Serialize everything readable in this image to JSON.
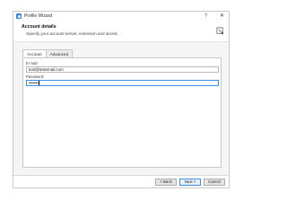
{
  "window": {
    "title": "Profile Wizard",
    "help_glyph": "?",
    "close_glyph": "✕"
  },
  "header": {
    "title": "Account details",
    "subtitle": "Specify your account server, extension and secret.",
    "icon": "account-settings-icon"
  },
  "tabs": [
    {
      "label": "Account",
      "active": true
    },
    {
      "label": "Advanced",
      "active": false
    }
  ],
  "form": {
    "email_label": "E-mail:",
    "email_value": "test@testemail.com",
    "password_label": "Password:",
    "password_value": "•••••••"
  },
  "buttons": {
    "back": "< Back",
    "next": "Next >",
    "cancel": "Cancel"
  },
  "colors": {
    "accent": "#3d8ee6",
    "app_icon": "#3b8ad9"
  }
}
